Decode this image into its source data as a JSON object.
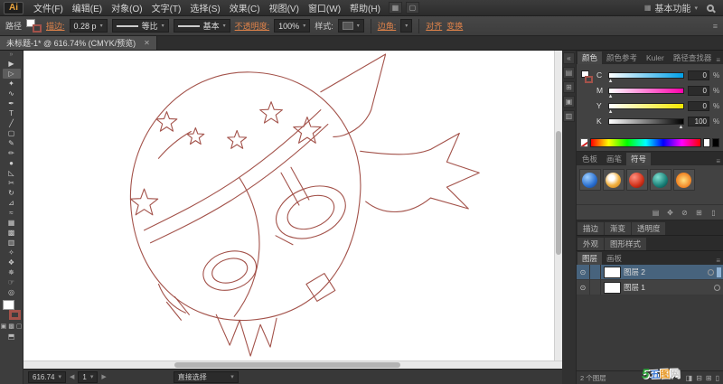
{
  "app": {
    "logo": "Ai",
    "menus": [
      "文件(F)",
      "编辑(E)",
      "对象(O)",
      "文字(T)",
      "选择(S)",
      "效果(C)",
      "视图(V)",
      "窗口(W)",
      "帮助(H)"
    ],
    "workspace": "基本功能",
    "accent_color": "#e0834a"
  },
  "control_bar": {
    "selection_label": "路径",
    "stroke_link": "描边:",
    "stroke_value": "0.28 p",
    "profile_value": "等比",
    "brush_value": "基本",
    "opacity_link": "不透明度:",
    "opacity_value": "100%",
    "style_label": "样式:",
    "corner_link": "边角:",
    "align_link": "对齐",
    "transform_link": "变换"
  },
  "document_tab": {
    "title": "未标题-1* @ 616.74% (CMYK/预览)",
    "close": "✕"
  },
  "tools": [
    {
      "name": "selection-tool",
      "glyph": "▶"
    },
    {
      "name": "direct-selection-tool",
      "glyph": "▷",
      "active": true
    },
    {
      "name": "magic-wand-tool",
      "glyph": "✦"
    },
    {
      "name": "lasso-tool",
      "glyph": "∿"
    },
    {
      "name": "pen-tool",
      "glyph": "✒"
    },
    {
      "name": "type-tool",
      "glyph": "T"
    },
    {
      "name": "line-tool",
      "glyph": "╱"
    },
    {
      "name": "rectangle-tool",
      "glyph": "▢"
    },
    {
      "name": "paintbrush-tool",
      "glyph": "✎"
    },
    {
      "name": "pencil-tool",
      "glyph": "✏"
    },
    {
      "name": "blob-brush-tool",
      "glyph": "●"
    },
    {
      "name": "eraser-tool",
      "glyph": "◺"
    },
    {
      "name": "scissors-tool",
      "glyph": "✂"
    },
    {
      "name": "rotate-tool",
      "glyph": "↻"
    },
    {
      "name": "scale-tool",
      "glyph": "⊿"
    },
    {
      "name": "width-tool",
      "glyph": "≈"
    },
    {
      "name": "free-transform-tool",
      "glyph": "▦"
    },
    {
      "name": "mesh-tool",
      "glyph": "▩"
    },
    {
      "name": "gradient-tool",
      "glyph": "▥"
    },
    {
      "name": "eyedropper-tool",
      "glyph": "✧"
    },
    {
      "name": "blend-tool",
      "glyph": "❖"
    },
    {
      "name": "symbol-sprayer-tool",
      "glyph": "✵"
    },
    {
      "name": "hand-tool",
      "glyph": "☞"
    },
    {
      "name": "zoom-tool",
      "glyph": "◎"
    }
  ],
  "dock_strip": [
    {
      "name": "collapse-dock-icon",
      "glyph": "«"
    },
    {
      "name": "info-panel-icon",
      "glyph": "▤"
    },
    {
      "name": "transform-panel-icon",
      "glyph": "⊞"
    },
    {
      "name": "pathfinder-panel-icon",
      "glyph": "▣"
    },
    {
      "name": "align-panel-icon",
      "glyph": "▥"
    }
  ],
  "panels": {
    "color": {
      "tabs": [
        "颜色",
        "颜色参考",
        "Kuler",
        "路径查找器"
      ],
      "channels": [
        {
          "label": "C",
          "value": "0",
          "unit": "%",
          "pos": "2%",
          "cls": "c"
        },
        {
          "label": "M",
          "value": "0",
          "unit": "%",
          "pos": "2%",
          "cls": "m"
        },
        {
          "label": "Y",
          "value": "0",
          "unit": "%",
          "pos": "2%",
          "cls": "y"
        },
        {
          "label": "K",
          "value": "100",
          "unit": "%",
          "pos": "97%",
          "cls": "k"
        }
      ]
    },
    "symbols": {
      "tabs": [
        "色板",
        "画笔",
        "符号"
      ],
      "items": [
        {
          "name": "symbol-blue-orb",
          "bg": "radial-gradient(circle at 35% 30%, #9fd0ff, #2a6fd0 60%, #123a80)"
        },
        {
          "name": "symbol-dotted-ball",
          "bg": "radial-gradient(circle at 40% 35%, #ffffff 20%, #f0b040 55%, #c07010)"
        },
        {
          "name": "symbol-red-orb",
          "bg": "radial-gradient(circle at 35% 30%, #ff9080, #d03018 60%, #701008)"
        },
        {
          "name": "symbol-teal-orb",
          "bg": "radial-gradient(circle at 35% 30%, #80e0d0, #1a8078 60%, #063a38)"
        },
        {
          "name": "symbol-star-burst",
          "bg": "radial-gradient(circle at 50% 50%, #ffe080, #f08020 70%, #a04010)"
        }
      ],
      "buttons": [
        {
          "name": "symbol-library-icon",
          "glyph": "▤"
        },
        {
          "name": "place-symbol-icon",
          "glyph": "✥"
        },
        {
          "name": "break-link-icon",
          "glyph": "⊘"
        },
        {
          "name": "new-symbol-icon",
          "glyph": "⊞"
        },
        {
          "name": "delete-symbol-icon",
          "glyph": "▯"
        }
      ]
    },
    "stroke_tabs": [
      "描边",
      "渐变",
      "透明度"
    ],
    "appearance_tabs": [
      "外观",
      "图形样式"
    ],
    "layers": {
      "tabs": [
        "图层",
        "画板"
      ],
      "items": [
        {
          "name": "图层 2",
          "selected": true
        },
        {
          "name": "图层 1",
          "selected": false
        }
      ],
      "count": "2 个图层",
      "buttons": [
        {
          "name": "make-clip-mask-icon",
          "glyph": "◨"
        },
        {
          "name": "new-sublayer-icon",
          "glyph": "⊟"
        },
        {
          "name": "new-layer-icon",
          "glyph": "⊞"
        },
        {
          "name": "delete-layer-icon",
          "glyph": "▯"
        }
      ]
    }
  },
  "status_bar": {
    "zoom": "616.74",
    "artboard": "1",
    "tool": "直接选择"
  },
  "watermark": {
    "mark": "5",
    "chars": [
      "五",
      "图",
      "网"
    ]
  },
  "canvas": {
    "artwork": {
      "stroke": "#a3524a",
      "paths": [
        "M119,170 C115,92 175,22 252,24 C330,26 378,88 374,158 C370,232 332,294 252,300 C176,305 123,248 119,170 Z",
        "M134,200 C190,172 245,148 330,66",
        "M141,214 C200,186 258,158 338,82",
        "M240,142 C272,192 268,252 234,296",
        "M330,46 L402,4 L386,66 C378,86 358,96 344,96",
        "M374,112 C404,116 432,118 452,110 L484,92 L470,124 L506,136 L470,152 L494,176 L452,164 C428,184 400,184 380,168",
        "M286,136 L306,172",
        "M297,130 L317,166",
        "M314,260 L334,248 L346,267 L326,279 Z",
        "M214,294 L229,328 L240,300 L252,340 L263,305 L274,330 L281,298",
        "M168,274 L184,294",
        "M159,280 L175,300",
        "M150,260 C156,276 166,286 180,292",
        "M280,206 L299,216",
        "M150,120 C160,108 172,98 186,90"
      ],
      "ellipses": [
        [
          319,
          180,
          40,
          27,
          -22
        ],
        [
          319,
          180,
          27,
          17,
          -22
        ],
        [
          229,
          245,
          30,
          21,
          -16
        ],
        [
          229,
          245,
          20,
          13,
          -16
        ]
      ],
      "stars": [
        [
          159,
          80,
          12
        ],
        [
          191,
          96,
          10
        ],
        [
          237,
          100,
          11
        ],
        [
          275,
          70,
          13
        ],
        [
          315,
          90,
          16
        ],
        [
          134,
          170,
          16
        ]
      ]
    }
  }
}
